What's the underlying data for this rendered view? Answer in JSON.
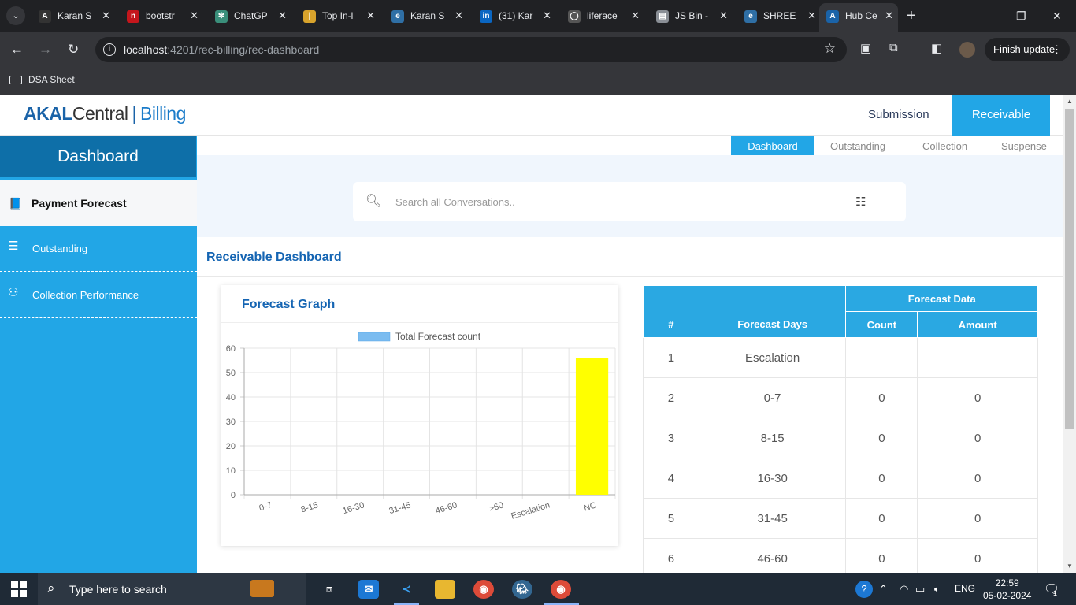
{
  "browser": {
    "tabs": [
      {
        "label": "Karan S",
        "icon": "letter-a-icon",
        "color": "#333333",
        "glyph": "A"
      },
      {
        "label": "bootstr",
        "icon": "n-icon",
        "color": "#c4161c",
        "glyph": "n"
      },
      {
        "label": "ChatGP",
        "icon": "chatgpt-icon",
        "color": "#3a8f7b",
        "glyph": "✻"
      },
      {
        "label": "Top In-l",
        "icon": "bookmark-icon",
        "color": "#d8a32c",
        "glyph": "|"
      },
      {
        "label": "Karan S",
        "icon": "edge-icon",
        "color": "#2f6fa5",
        "glyph": "e"
      },
      {
        "label": "(31) Kar",
        "icon": "linkedin-icon",
        "color": "#0a66c2",
        "glyph": "in"
      },
      {
        "label": "liferace",
        "icon": "github-icon",
        "color": "#555555",
        "glyph": "◯"
      },
      {
        "label": "JS Bin -",
        "icon": "jsbin-icon",
        "color": "#8a8f96",
        "glyph": "▤"
      },
      {
        "label": "SHREE",
        "icon": "edge-icon",
        "color": "#2f6fa5",
        "glyph": "e"
      },
      {
        "label": "Hub Ce",
        "icon": "letter-a-icon",
        "color": "#1a63a8",
        "glyph": "A"
      }
    ],
    "url_host": "localhost",
    "url_rest": ":4201/rec-billing/rec-dashboard",
    "finish_update": "Finish update",
    "bookmark": "DSA Sheet"
  },
  "app": {
    "logo_akal": "AKAL",
    "logo_central": "Central",
    "logo_billing": "Billing",
    "nav": {
      "submission": "Submission",
      "receivable": "Receivable"
    },
    "sidebar": {
      "title": "Dashboard",
      "active_item": "Payment Forecast",
      "items": [
        "Outstanding",
        "Collection Performance"
      ]
    },
    "subtabs": [
      "Dashboard",
      "Outstanding",
      "Collection",
      "Suspense"
    ],
    "search_placeholder": "Search all Conversations..",
    "section_title": "Receivable Dashboard",
    "card_title": "Forecast Graph",
    "colors": {
      "accent": "#22a6e6",
      "dark_accent": "#0e6fa8",
      "title_blue": "#1565b3",
      "bar": "#ffff00",
      "legend": "#7bbcf0"
    }
  },
  "chart_data": {
    "type": "bar",
    "categories": [
      "0-7",
      "8-15",
      "16-30",
      "31-45",
      "46-60",
      ">60",
      "Escalation",
      "NC"
    ],
    "series": [
      {
        "name": "Total Forecast count",
        "values": [
          0,
          0,
          0,
          0,
          0,
          0,
          0,
          56
        ]
      }
    ],
    "ylim": [
      0,
      60
    ],
    "yticks": [
      0,
      10,
      20,
      30,
      40,
      50,
      60
    ],
    "grid": true,
    "legend": "top"
  },
  "table": {
    "header_num": "#",
    "header_days": "Forecast Days",
    "header_group": "Forecast Data",
    "header_count": "Count",
    "header_amount": "Amount",
    "rows": [
      {
        "num": "1",
        "days": "Escalation",
        "count": "",
        "amount": ""
      },
      {
        "num": "2",
        "days": "0-7",
        "count": "0",
        "amount": "0"
      },
      {
        "num": "3",
        "days": "8-15",
        "count": "0",
        "amount": "0"
      },
      {
        "num": "4",
        "days": "16-30",
        "count": "0",
        "amount": "0"
      },
      {
        "num": "5",
        "days": "31-45",
        "count": "0",
        "amount": "0"
      },
      {
        "num": "6",
        "days": "46-60",
        "count": "0",
        "amount": "0"
      }
    ]
  },
  "taskbar": {
    "search_text": "Type here to search",
    "lang": "ENG",
    "time": "22:59",
    "date": "05-02-2024",
    "notif_count": "1"
  }
}
